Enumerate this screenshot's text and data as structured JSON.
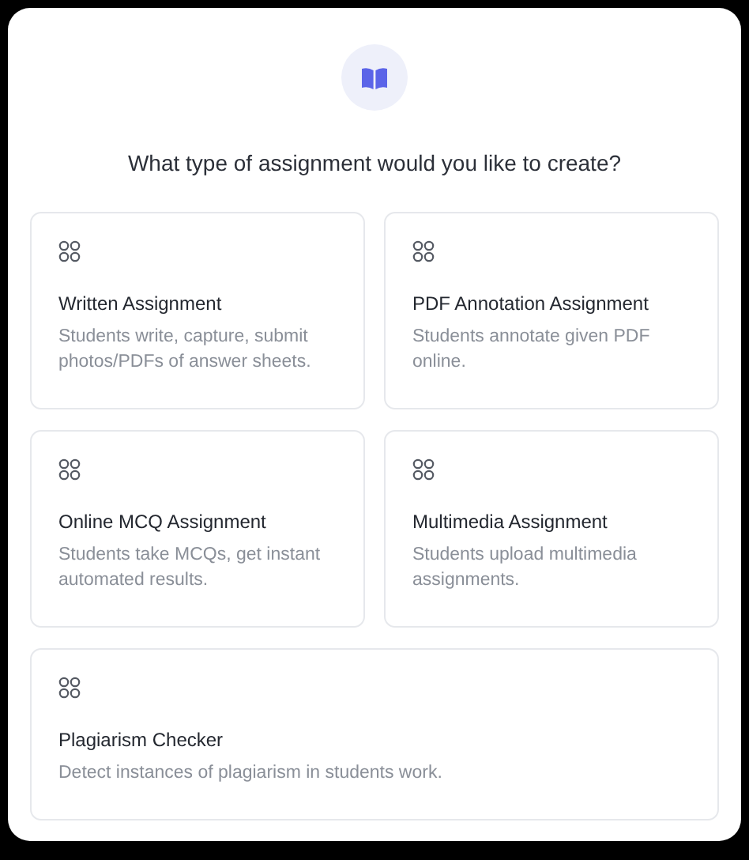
{
  "dialog": {
    "question": "What type of assignment would you like to create?",
    "options": [
      {
        "title": "Written Assignment",
        "description": "Students write, capture, submit photos/PDFs of answer sheets."
      },
      {
        "title": "PDF Annotation Assignment",
        "description": "Students annotate given PDF online."
      },
      {
        "title": "Online MCQ Assignment",
        "description": "Students take MCQs, get instant automated results."
      },
      {
        "title": "Multimedia Assignment",
        "description": "Students upload multimedia assignments."
      },
      {
        "title": "Plagiarism Checker",
        "description": "Detect instances of plagiarism in students work."
      }
    ]
  }
}
